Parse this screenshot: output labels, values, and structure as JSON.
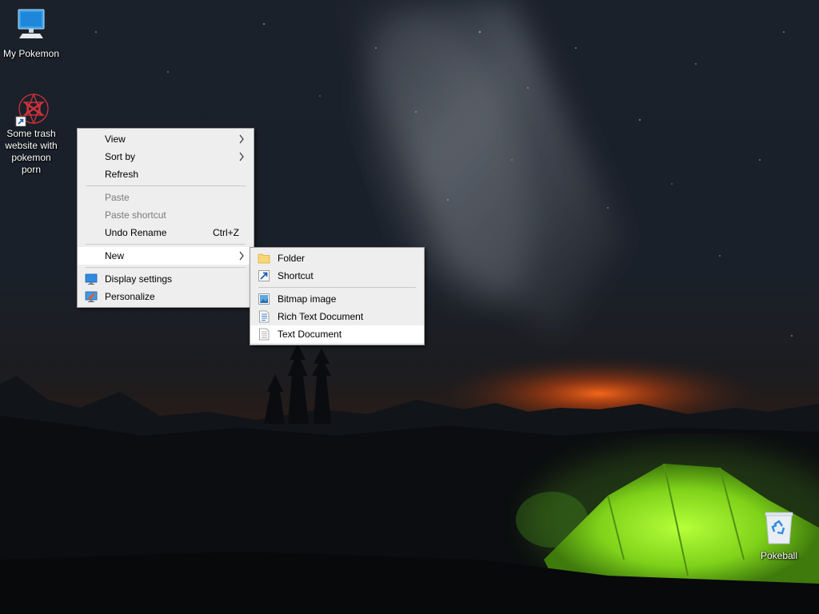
{
  "desktop": {
    "icons": [
      {
        "label": "My Pokemon",
        "icon": "computer-icon"
      },
      {
        "label": "Some trash website with pokemon porn",
        "icon": "web-shortcut-icon"
      },
      {
        "label": "Pokeball",
        "icon": "recycle-bin-icon"
      }
    ]
  },
  "context_menu": {
    "items": [
      {
        "label": "View",
        "submenu": true
      },
      {
        "label": "Sort by",
        "submenu": true
      },
      {
        "label": "Refresh"
      },
      {
        "label": "Paste",
        "disabled": true
      },
      {
        "label": "Paste shortcut",
        "disabled": true
      },
      {
        "label": "Undo Rename",
        "shortcut": "Ctrl+Z"
      },
      {
        "label": "New",
        "submenu": true,
        "active": true
      },
      {
        "label": "Display settings",
        "icon": "display-icon"
      },
      {
        "label": "Personalize",
        "icon": "personalize-icon"
      }
    ]
  },
  "new_submenu": {
    "items": [
      {
        "label": "Folder",
        "icon": "folder-icon"
      },
      {
        "label": "Shortcut",
        "icon": "shortcut-icon"
      },
      {
        "label": "Bitmap image",
        "icon": "bitmap-icon"
      },
      {
        "label": "Rich Text Document",
        "icon": "rich-text-icon"
      },
      {
        "label": "Text Document",
        "icon": "text-document-icon",
        "active": true
      }
    ]
  }
}
